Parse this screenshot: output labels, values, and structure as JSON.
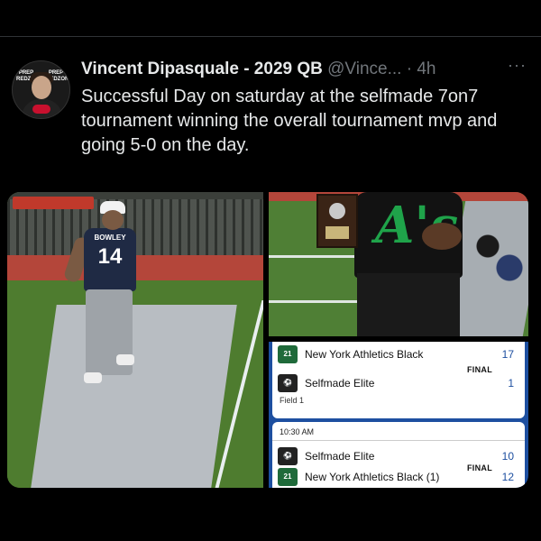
{
  "tweet": {
    "author_name": "Vincent Dipasquale - 2029 QB",
    "handle": "@Vince...",
    "separator": "·",
    "time": "4h",
    "more_icon": "more-horizontal-icon",
    "text": "Successful Day on saturday at the selfmade 7on7 tournament winning the overall tournament mvp and going 5-0 on the day."
  },
  "avatar": {
    "banner_left": "PREP REDZONE",
    "banner_right": "PREP REDZONE"
  },
  "photos": {
    "player_name_on_jersey": "BOWLEY",
    "player_number": "14"
  },
  "scores": {
    "game1": {
      "team1": "New York Athletics Black",
      "team1_score": "17",
      "team1_logo": "21",
      "status": "FINAL",
      "team2": "Selfmade Elite",
      "team2_score": "1",
      "field": "Field 1"
    },
    "game2": {
      "time": "10:30 AM",
      "team1": "Selfmade Elite",
      "team1_score": "10",
      "status": "FINAL",
      "team2": "New York Athletics Black (1)",
      "team2_score": "12",
      "team2_logo": "21"
    }
  },
  "colors": {
    "background": "#000000",
    "text_primary": "#e7e9ea",
    "text_secondary": "#71767b",
    "score_panel": "#1d4fa0"
  }
}
